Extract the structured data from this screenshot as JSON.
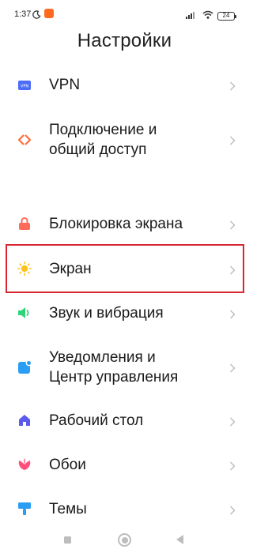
{
  "status_bar": {
    "time": "1:37",
    "battery": "24"
  },
  "title": "Настройки",
  "items": [
    {
      "label": "VPN",
      "icon": "vpn-icon"
    },
    {
      "label_line1": "Подключение и",
      "label_line2": "общий доступ",
      "icon": "share-connection-icon"
    },
    {
      "label": "Блокировка экрана",
      "icon": "lock-icon"
    },
    {
      "label": "Экран",
      "icon": "sun-icon"
    },
    {
      "label": "Звук и вибрация",
      "icon": "speaker-icon"
    },
    {
      "label_line1": "Уведомления и",
      "label_line2": "Центр управления",
      "icon": "notification-icon"
    },
    {
      "label": "Рабочий стол",
      "icon": "home-icon"
    },
    {
      "label": "Обои",
      "icon": "flower-icon"
    },
    {
      "label": "Темы",
      "icon": "brush-icon"
    }
  ],
  "colors": {
    "highlight": "#d9262f",
    "vpn": "#4a6cf7",
    "share": "#ff6b3d",
    "lock": "#ff6b5b",
    "sun": "#ffc21a",
    "sound": "#2fd47a",
    "notification": "#2a9df4",
    "home": "#5b5bf0",
    "flower": "#ff4f7b",
    "brush": "#2a9df4"
  }
}
